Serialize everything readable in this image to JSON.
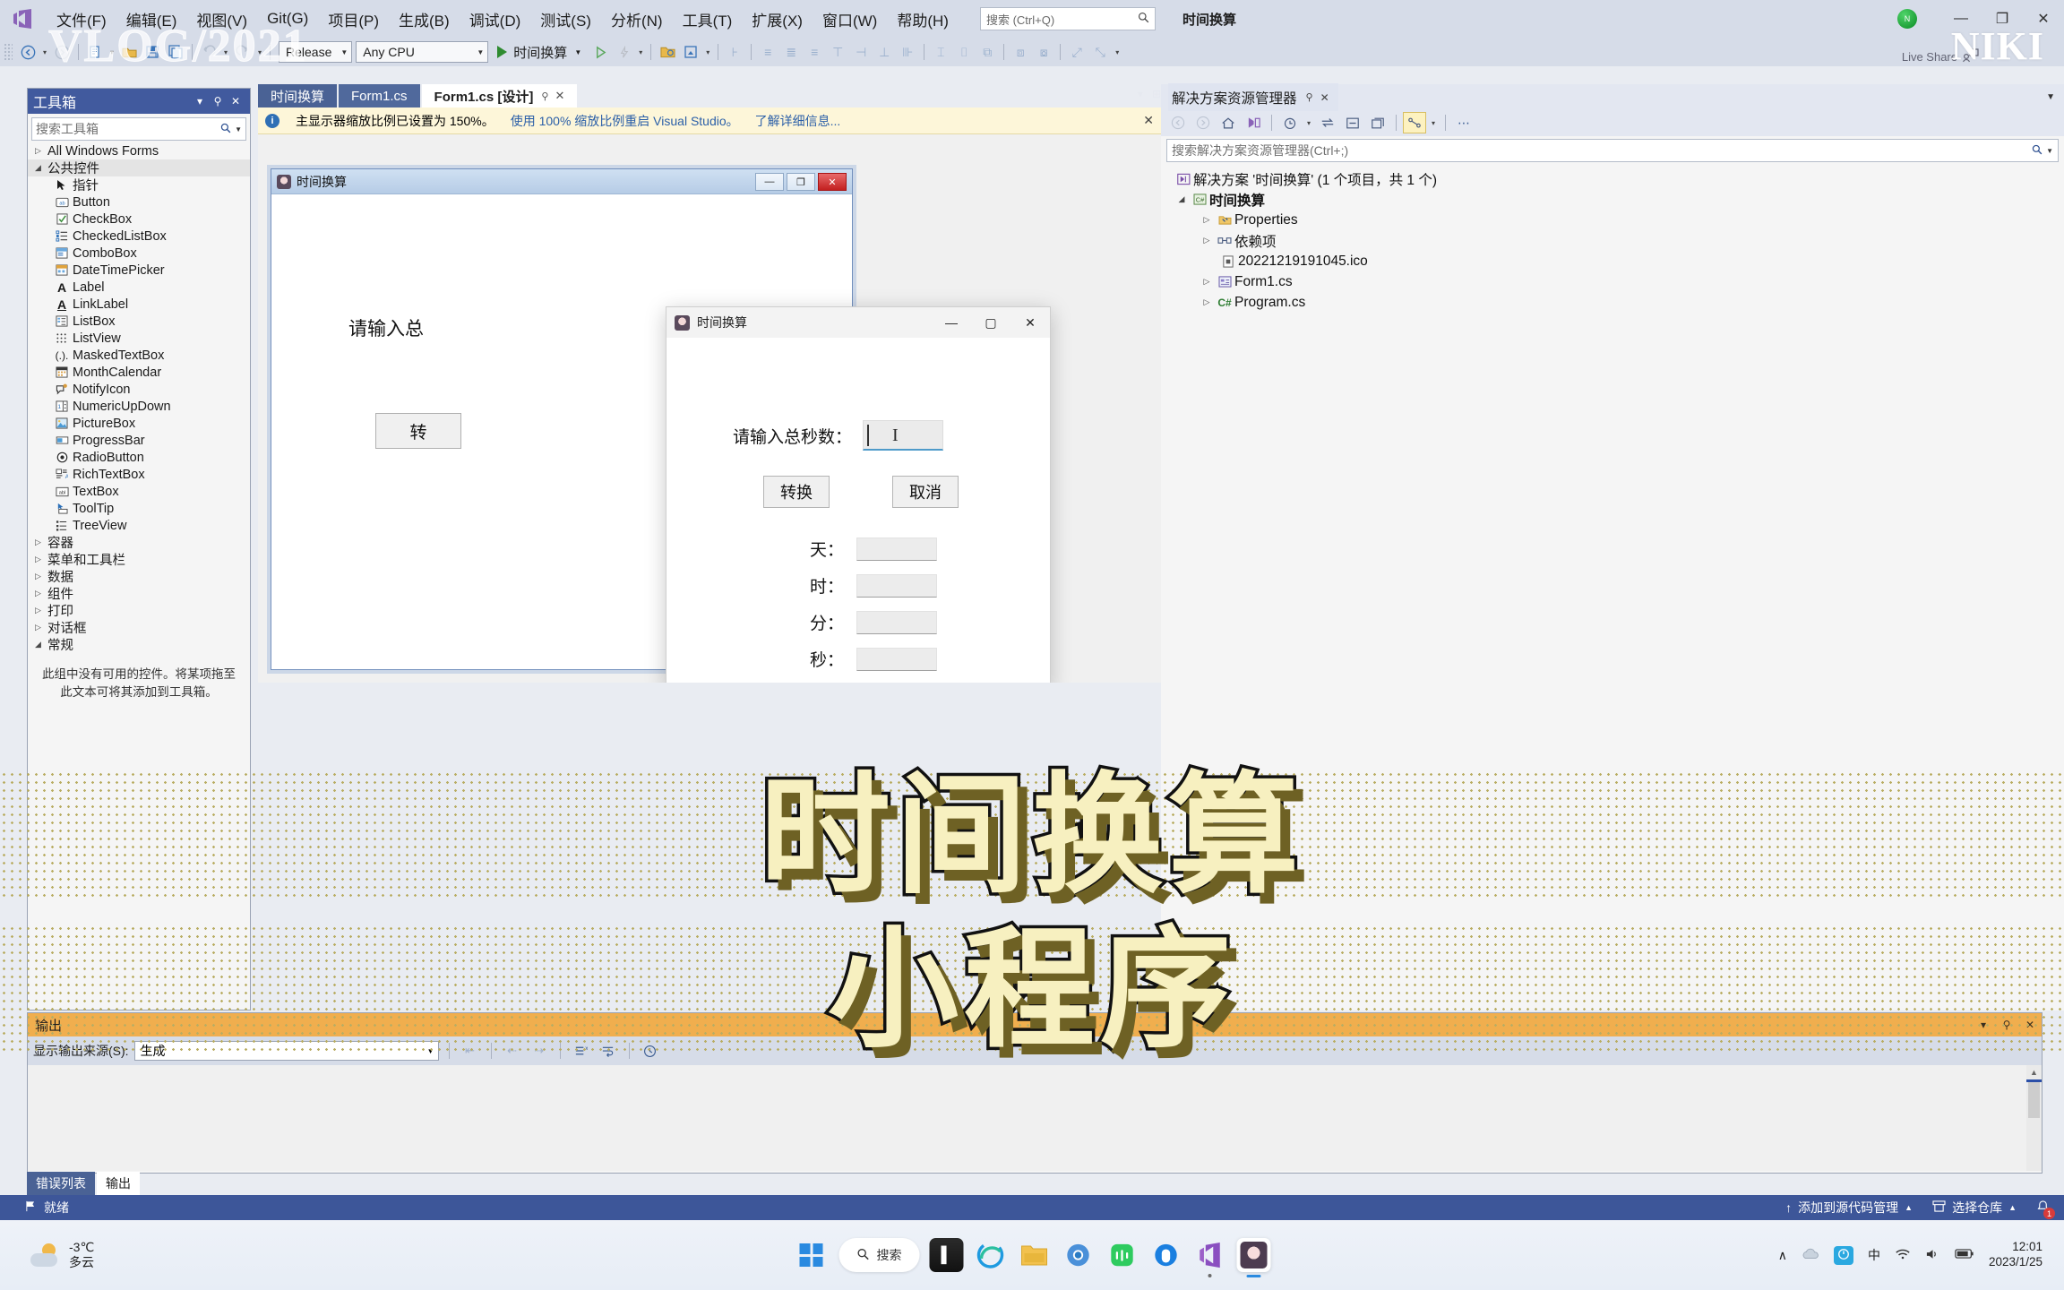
{
  "titlebar": {
    "menu": [
      "文件(F)",
      "编辑(E)",
      "视图(V)",
      "Git(G)",
      "项目(P)",
      "生成(B)",
      "调试(D)",
      "测试(S)",
      "分析(N)",
      "工具(T)",
      "扩展(X)",
      "窗口(W)",
      "帮助(H)"
    ],
    "search_placeholder": "搜索 (Ctrl+Q)",
    "solution_name": "时间换算",
    "avatar_initial": "N",
    "minimize": "—",
    "restore": "❐",
    "close": "✕"
  },
  "toolbar": {
    "configuration": "Release",
    "platform": "Any CPU",
    "run_target": "时间换算",
    "icons": [
      "back-icon",
      "forward-icon",
      "new-item-icon",
      "open-icon",
      "save-icon",
      "save-all-icon",
      "undo-icon",
      "redo-icon"
    ]
  },
  "toolbox": {
    "title": "工具箱",
    "search_placeholder": "搜索工具箱",
    "groups": [
      {
        "label": "All Windows Forms",
        "expanded": false
      },
      {
        "label": "公共控件",
        "expanded": true
      }
    ],
    "items": [
      {
        "label": "指针",
        "icon": "pointer-icon"
      },
      {
        "label": "Button",
        "icon": "button-icon"
      },
      {
        "label": "CheckBox",
        "icon": "checkbox-icon"
      },
      {
        "label": "CheckedListBox",
        "icon": "checkedlistbox-icon"
      },
      {
        "label": "ComboBox",
        "icon": "combobox-icon"
      },
      {
        "label": "DateTimePicker",
        "icon": "datetimepicker-icon"
      },
      {
        "label": "Label",
        "icon": "label-icon"
      },
      {
        "label": "LinkLabel",
        "icon": "linklabel-icon"
      },
      {
        "label": "ListBox",
        "icon": "listbox-icon"
      },
      {
        "label": "ListView",
        "icon": "listview-icon"
      },
      {
        "label": "MaskedTextBox",
        "icon": "maskedtextbox-icon"
      },
      {
        "label": "MonthCalendar",
        "icon": "monthcalendar-icon"
      },
      {
        "label": "NotifyIcon",
        "icon": "notifyicon-icon"
      },
      {
        "label": "NumericUpDown",
        "icon": "numericupdown-icon"
      },
      {
        "label": "PictureBox",
        "icon": "picturebox-icon"
      },
      {
        "label": "ProgressBar",
        "icon": "progressbar-icon"
      },
      {
        "label": "RadioButton",
        "icon": "radiobutton-icon"
      },
      {
        "label": "RichTextBox",
        "icon": "richtextbox-icon"
      },
      {
        "label": "TextBox",
        "icon": "textbox-icon"
      },
      {
        "label": "ToolTip",
        "icon": "tooltip-icon"
      },
      {
        "label": "TreeView",
        "icon": "treeview-icon"
      }
    ],
    "trailing_groups": [
      {
        "label": "容器",
        "expanded": false
      },
      {
        "label": "菜单和工具栏",
        "expanded": false
      },
      {
        "label": "数据",
        "expanded": false
      },
      {
        "label": "组件",
        "expanded": false
      },
      {
        "label": "打印",
        "expanded": false
      },
      {
        "label": "对话框",
        "expanded": false
      },
      {
        "label": "常规",
        "expanded": true
      }
    ],
    "empty_message": "此组中没有可用的控件。将某项拖至此文本可将其添加到工具箱。"
  },
  "editor": {
    "tabs": [
      {
        "label": "时间换算",
        "active": false
      },
      {
        "label": "Form1.cs",
        "active": false
      },
      {
        "label": "Form1.cs [设计]",
        "active": true
      }
    ],
    "infobar": {
      "message": "主显示器缩放比例已设置为 150%。",
      "action": "使用 100% 缩放比例重启 Visual Studio。",
      "more": "了解详细信息...",
      "close": "✕"
    }
  },
  "host_form": {
    "title": "时间换算",
    "label": "请输入总",
    "button": "转",
    "minimize": "—",
    "restore": "❐",
    "close": "✕"
  },
  "dialog": {
    "title": "时间换算",
    "minimize": "—",
    "maximize": "▢",
    "close": "✕",
    "input_label": "请输入总秒数：",
    "input_value": "",
    "buttons": [
      {
        "label": "转换",
        "name": "convert-button"
      },
      {
        "label": "取消",
        "name": "cancel-button"
      }
    ],
    "results": [
      {
        "label": "天：",
        "value": ""
      },
      {
        "label": "时：",
        "value": ""
      },
      {
        "label": "分：",
        "value": ""
      },
      {
        "label": "秒：",
        "value": ""
      }
    ]
  },
  "solution_explorer": {
    "title": "解决方案资源管理器",
    "pin": "⚲",
    "close": "✕",
    "search_placeholder": "搜索解决方案资源管理器(Ctrl+;)",
    "root": "解决方案 '时间换算' (1 个项目，共 1 个)",
    "project": "时间换算",
    "nodes": [
      {
        "label": "Properties",
        "icon": "properties-folder-icon",
        "expandable": true
      },
      {
        "label": "依赖项",
        "icon": "dependencies-icon",
        "expandable": true
      },
      {
        "label": "20221219191045.ico",
        "icon": "ico-file-icon",
        "expandable": false
      },
      {
        "label": "Form1.cs",
        "icon": "form-file-icon",
        "expandable": true
      },
      {
        "label": "Program.cs",
        "icon": "csharp-file-icon",
        "expandable": true
      }
    ]
  },
  "output_panel": {
    "title": "输出",
    "source_label": "显示输出来源(S):",
    "source_value": "生成",
    "content": ""
  },
  "bottom_tabs": [
    {
      "label": "错误列表",
      "active": false
    },
    {
      "label": "输出",
      "active": true
    }
  ],
  "status_bar": {
    "ready": "就绪",
    "source_control": "添加到源代码管理",
    "repo": "选择仓库",
    "notification_count": "1"
  },
  "taskbar": {
    "weather_temp": "-3℃",
    "weather_desc": "多云",
    "search_label": "搜索",
    "time": "12:01",
    "date": "2023/1/25",
    "tray_ime": "中",
    "apps": [
      "start-icon",
      "search-icon",
      "terminal-icon",
      "edge-legacy-icon",
      "file-explorer-icon",
      "chrome-icon",
      "wechat-icon",
      "qq-icon",
      "visual-studio-icon",
      "app-icon"
    ]
  },
  "overlay": {
    "watermark_left": "VLOG/2021",
    "watermark_right": "NIKI",
    "live_share": "Live Share",
    "big_line1": "时间换算",
    "big_line2": "小程序"
  },
  "colors": {
    "accent": "#3d5699",
    "panel_header": "#415a9e",
    "output_header": "#f0ae4e",
    "info_bar": "#fdf6d9",
    "big_text_fill": "#f7f0c0",
    "big_text_shadow": "#6e6124"
  }
}
